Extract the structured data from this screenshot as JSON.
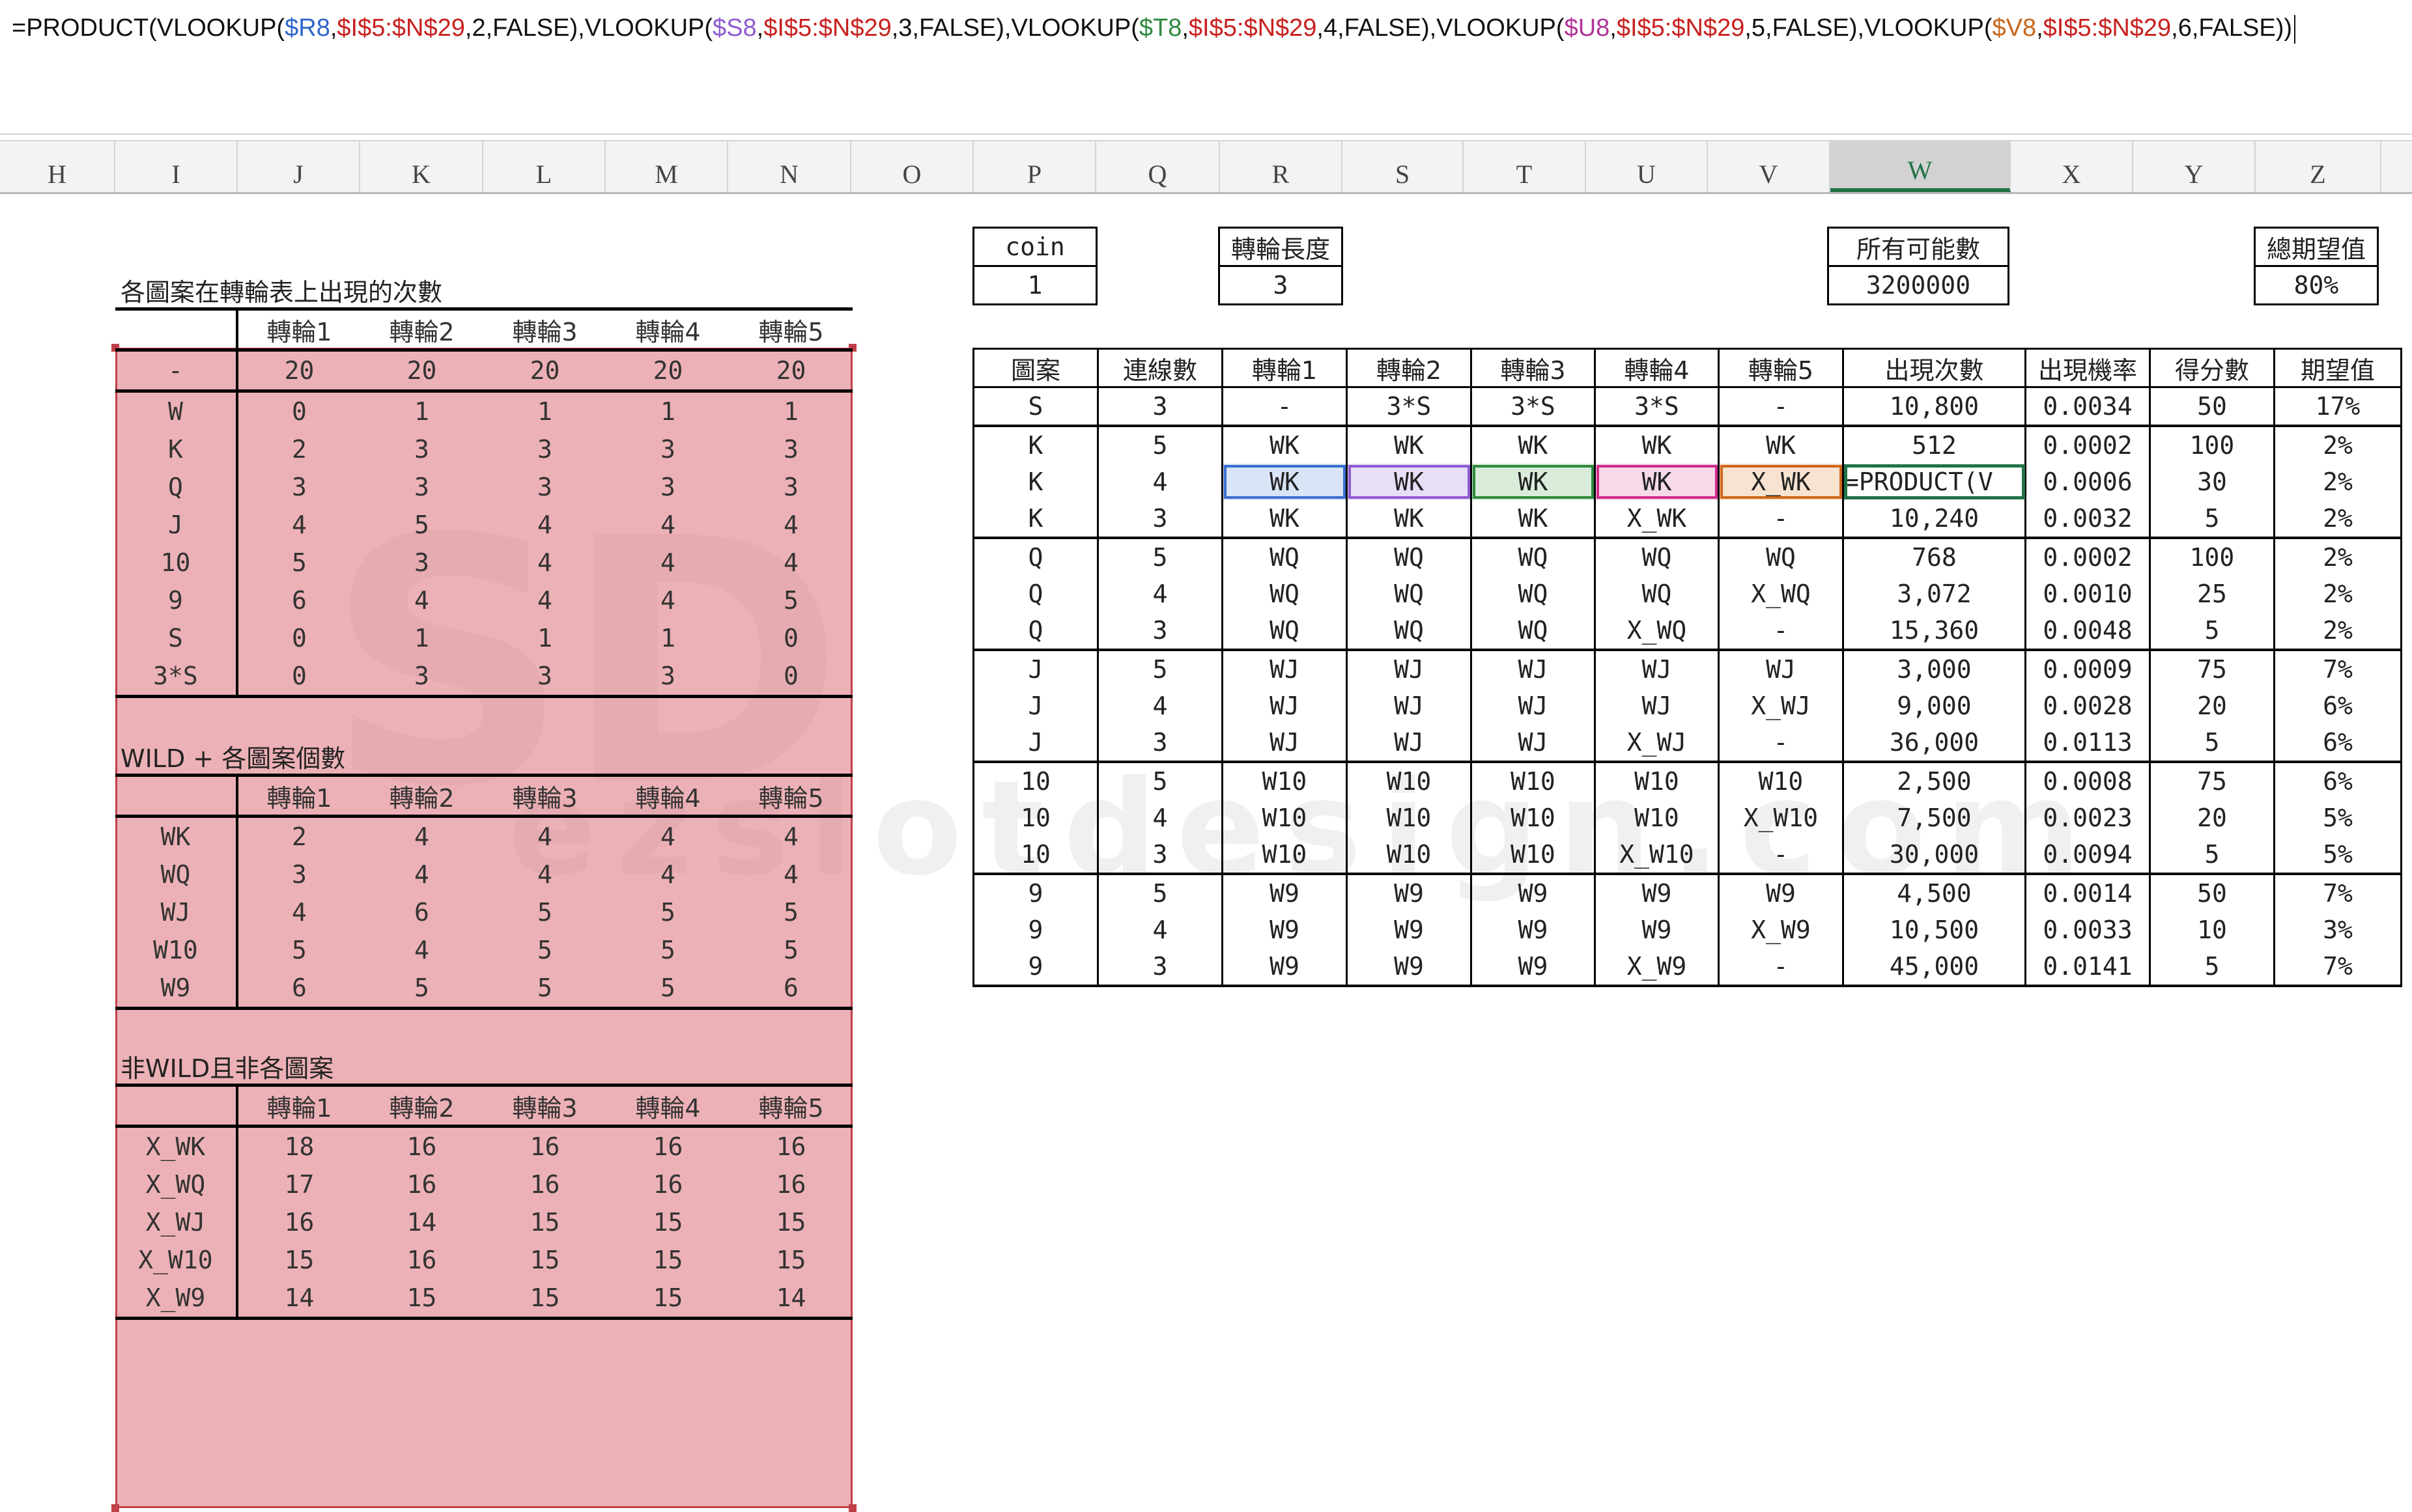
{
  "formula": {
    "parts": [
      {
        "t": "=PRODUCT(VLOOKUP(",
        "c": "#111"
      },
      {
        "t": "$R8",
        "c": "#2f65c9"
      },
      {
        "t": ",",
        "c": "#111"
      },
      {
        "t": "$I$5:$N$29",
        "c": "#c8201e"
      },
      {
        "t": ",2,FALSE),VLOOKUP(",
        "c": "#111"
      },
      {
        "t": "$S8",
        "c": "#8f5bd1"
      },
      {
        "t": ",",
        "c": "#111"
      },
      {
        "t": "$I$5:$N$29",
        "c": "#c8201e"
      },
      {
        "t": ",3,FALSE),VLOOKUP(",
        "c": "#111"
      },
      {
        "t": "$T8",
        "c": "#2f8a3e"
      },
      {
        "t": ",",
        "c": "#111"
      },
      {
        "t": "$I$5:$N$29",
        "c": "#c8201e"
      },
      {
        "t": ",4,FALSE),VLOOKUP(",
        "c": "#111"
      },
      {
        "t": "$U8",
        "c": "#b03497"
      },
      {
        "t": ",",
        "c": "#111"
      },
      {
        "t": "$I$5:$N$29",
        "c": "#c8201e"
      },
      {
        "t": ",5,FALSE),VLOOKUP(",
        "c": "#111"
      },
      {
        "t": "$V8",
        "c": "#c8661a"
      },
      {
        "t": ",",
        "c": "#111"
      },
      {
        "t": "$I$5:$N$29",
        "c": "#c8201e"
      },
      {
        "t": ",6,FALSE))",
        "c": "#111"
      }
    ]
  },
  "columns": {
    "labels": [
      "H",
      "I",
      "J",
      "K",
      "L",
      "M",
      "N",
      "O",
      "P",
      "Q",
      "R",
      "S",
      "T",
      "U",
      "V",
      "W",
      "X",
      "Y",
      "Z"
    ],
    "selected": "W"
  },
  "left": {
    "title1": "各圖案在轉輪表上出現的次數",
    "title2": "WILD + 各圖案個數",
    "title3": "非WILD且非各圖案",
    "reel_headers": [
      "轉輪1",
      "轉輪2",
      "轉輪3",
      "轉輪4",
      "轉輪5"
    ],
    "table1": [
      [
        "-",
        "20",
        "20",
        "20",
        "20",
        "20"
      ],
      [
        "W",
        "0",
        "1",
        "1",
        "1",
        "1"
      ],
      [
        "K",
        "2",
        "3",
        "3",
        "3",
        "3"
      ],
      [
        "Q",
        "3",
        "3",
        "3",
        "3",
        "3"
      ],
      [
        "J",
        "4",
        "5",
        "4",
        "4",
        "4"
      ],
      [
        "10",
        "5",
        "3",
        "4",
        "4",
        "4"
      ],
      [
        "9",
        "6",
        "4",
        "4",
        "4",
        "5"
      ],
      [
        "S",
        "0",
        "1",
        "1",
        "1",
        "0"
      ],
      [
        "3*S",
        "0",
        "3",
        "3",
        "3",
        "0"
      ]
    ],
    "table2": [
      [
        "WK",
        "2",
        "4",
        "4",
        "4",
        "4"
      ],
      [
        "WQ",
        "3",
        "4",
        "4",
        "4",
        "4"
      ],
      [
        "WJ",
        "4",
        "6",
        "5",
        "5",
        "5"
      ],
      [
        "W10",
        "5",
        "4",
        "5",
        "5",
        "5"
      ],
      [
        "W9",
        "6",
        "5",
        "5",
        "5",
        "6"
      ]
    ],
    "table3": [
      [
        "X_WK",
        "18",
        "16",
        "16",
        "16",
        "16"
      ],
      [
        "X_WQ",
        "17",
        "16",
        "16",
        "16",
        "16"
      ],
      [
        "X_WJ",
        "16",
        "14",
        "15",
        "15",
        "15"
      ],
      [
        "X_W10",
        "15",
        "16",
        "15",
        "15",
        "15"
      ],
      [
        "X_W9",
        "14",
        "15",
        "15",
        "15",
        "14"
      ]
    ]
  },
  "right": {
    "coin_label": "coin",
    "coin_value": "1",
    "reel_len_label": "轉輪長度",
    "reel_len_value": "3",
    "all_label": "所有可能數",
    "all_value": "3200000",
    "ev_label": "總期望值",
    "ev_value": "80%",
    "headers": [
      "圖案",
      "連線數",
      "轉輪1",
      "轉輪2",
      "轉輪3",
      "轉輪4",
      "轉輪5",
      "出現次數",
      "出現機率",
      "得分數",
      "期望值"
    ],
    "rows": [
      [
        "S",
        "3",
        "-",
        "3*S",
        "3*S",
        "3*S",
        "-",
        "10,800",
        "0.0034",
        "50",
        "17%"
      ],
      [
        "K",
        "5",
        "WK",
        "WK",
        "WK",
        "WK",
        "WK",
        "512",
        "0.0002",
        "100",
        "2%"
      ],
      [
        "K",
        "4",
        "WK",
        "WK",
        "WK",
        "WK",
        "X_WK",
        "=PRODUCT(V",
        "0.0006",
        "30",
        "2%"
      ],
      [
        "K",
        "3",
        "WK",
        "WK",
        "WK",
        "X_WK",
        "-",
        "10,240",
        "0.0032",
        "5",
        "2%"
      ],
      [
        "Q",
        "5",
        "WQ",
        "WQ",
        "WQ",
        "WQ",
        "WQ",
        "768",
        "0.0002",
        "100",
        "2%"
      ],
      [
        "Q",
        "4",
        "WQ",
        "WQ",
        "WQ",
        "WQ",
        "X_WQ",
        "3,072",
        "0.0010",
        "25",
        "2%"
      ],
      [
        "Q",
        "3",
        "WQ",
        "WQ",
        "WQ",
        "X_WQ",
        "-",
        "15,360",
        "0.0048",
        "5",
        "2%"
      ],
      [
        "J",
        "5",
        "WJ",
        "WJ",
        "WJ",
        "WJ",
        "WJ",
        "3,000",
        "0.0009",
        "75",
        "7%"
      ],
      [
        "J",
        "4",
        "WJ",
        "WJ",
        "WJ",
        "WJ",
        "X_WJ",
        "9,000",
        "0.0028",
        "20",
        "6%"
      ],
      [
        "J",
        "3",
        "WJ",
        "WJ",
        "WJ",
        "X_WJ",
        "-",
        "36,000",
        "0.0113",
        "5",
        "6%"
      ],
      [
        "10",
        "5",
        "W10",
        "W10",
        "W10",
        "W10",
        "W10",
        "2,500",
        "0.0008",
        "75",
        "6%"
      ],
      [
        "10",
        "4",
        "W10",
        "W10",
        "W10",
        "W10",
        "X_W10",
        "7,500",
        "0.0023",
        "20",
        "5%"
      ],
      [
        "10",
        "3",
        "W10",
        "W10",
        "W10",
        "X_W10",
        "-",
        "30,000",
        "0.0094",
        "5",
        "5%"
      ],
      [
        "9",
        "5",
        "W9",
        "W9",
        "W9",
        "W9",
        "W9",
        "4,500",
        "0.0014",
        "50",
        "7%"
      ],
      [
        "9",
        "4",
        "W9",
        "W9",
        "W9",
        "W9",
        "X_W9",
        "10,500",
        "0.0033",
        "10",
        "3%"
      ],
      [
        "9",
        "3",
        "W9",
        "W9",
        "W9",
        "X_W9",
        "-",
        "45,000",
        "0.0141",
        "5",
        "7%"
      ]
    ]
  },
  "colors": {
    "excel_green": "#217346",
    "range_red": "#c0404a"
  }
}
